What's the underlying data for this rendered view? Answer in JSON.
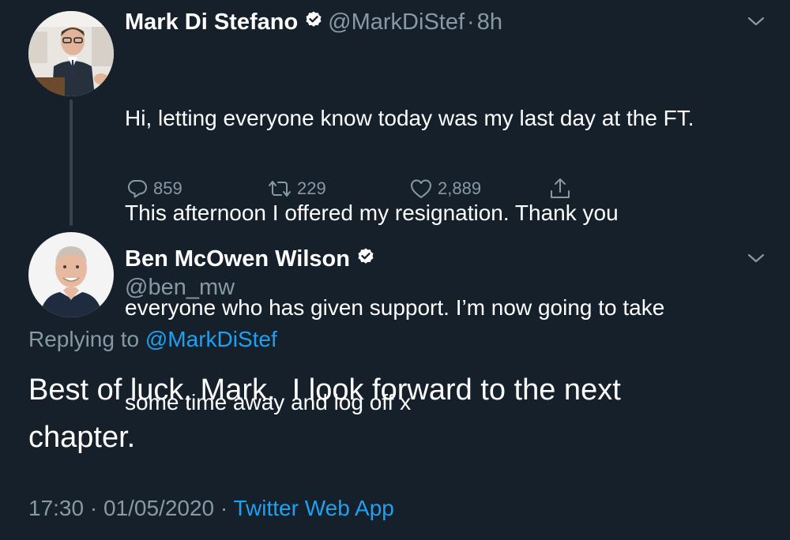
{
  "colors": {
    "background": "#15202b",
    "primary_text": "#ffffff",
    "secondary_text": "#8899a6",
    "accent": "#1da1f2",
    "thread_line": "#38444d"
  },
  "tweet1": {
    "avatar_icon": "profile-photo",
    "display_name": "Mark Di Stefano",
    "verified_icon": "verified-badge-icon",
    "handle": "@MarkDiStef",
    "separator": "·",
    "time": "8h",
    "text": "Hi, letting everyone know today was my last day at the FT. This afternoon I offered my resignation. Thank you everyone who has given support. I’m now going to take some time away and log off x",
    "text_lines": [
      "Hi, letting everyone know today was my last day at the FT.",
      "This afternoon I offered my resignation. Thank you",
      "everyone who has given support. I’m now going to take",
      "some time away and log off x"
    ],
    "actions": {
      "reply_count": "859",
      "retweet_count": "229",
      "like_count": "2,889"
    }
  },
  "tweet2": {
    "avatar_icon": "profile-photo",
    "display_name": "Ben McOwen Wilson",
    "verified_icon": "verified-badge-icon",
    "handle": "@ben_mw",
    "replying_prefix": "Replying to",
    "replying_mention": "@MarkDiStef",
    "text_line1": "Best of luck, Mark.  I look forward to the next",
    "text_line2": "chapter.",
    "time": "17:30",
    "date": "01/05/2020",
    "separator": "·",
    "app": "Twitter Web App"
  }
}
